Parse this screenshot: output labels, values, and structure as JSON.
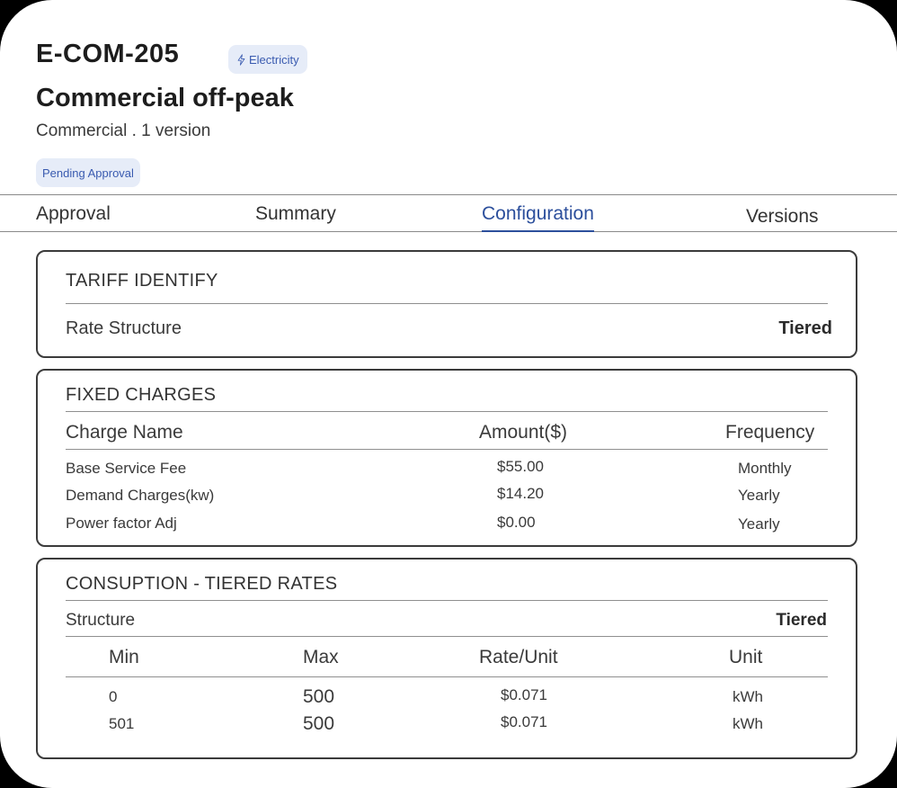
{
  "header": {
    "code": "E-COM-205",
    "type_badge": "Electricity",
    "name": "Commercial off-peak",
    "meta": "Commercial . 1 version",
    "status": "Pending Approval"
  },
  "tabs": [
    {
      "label": "Approval",
      "active": false
    },
    {
      "label": "Summary",
      "active": false
    },
    {
      "label": "Configuration",
      "active": true
    },
    {
      "label": "Versions",
      "active": false
    }
  ],
  "tariff_identify": {
    "title": "TARIFF IDENTIFY",
    "rate_structure_label": "Rate Structure",
    "rate_structure_value": "Tiered"
  },
  "fixed_charges": {
    "title": "FIXED CHARGES",
    "columns": [
      "Charge Name",
      "Amount($)",
      "Frequency"
    ],
    "rows": [
      {
        "name": "Base Service Fee",
        "amount": "$55.00",
        "frequency": "Monthly"
      },
      {
        "name": "Demand Charges(kw)",
        "amount": "$14.20",
        "frequency": "Yearly"
      },
      {
        "name": "Power factor Adj",
        "amount": "$0.00",
        "frequency": "Yearly"
      }
    ]
  },
  "consumption": {
    "title": "CONSUPTION - TIERED RATES",
    "structure_label": "Structure",
    "structure_value": "Tiered",
    "columns": [
      "Min",
      "Max",
      "Rate/Unit",
      "Unit"
    ],
    "rows": [
      {
        "min": "0",
        "max": "500",
        "rate": "$0.071",
        "unit": "kWh"
      },
      {
        "min": "501",
        "max": "500",
        "rate": "$0.071",
        "unit": "kWh"
      }
    ]
  },
  "colors": {
    "accent": "#2c4f9c",
    "badge_bg": "#e6ecf8",
    "badge_text": "#3a5bb0"
  },
  "icons": {
    "type_badge": "lightning-icon"
  }
}
